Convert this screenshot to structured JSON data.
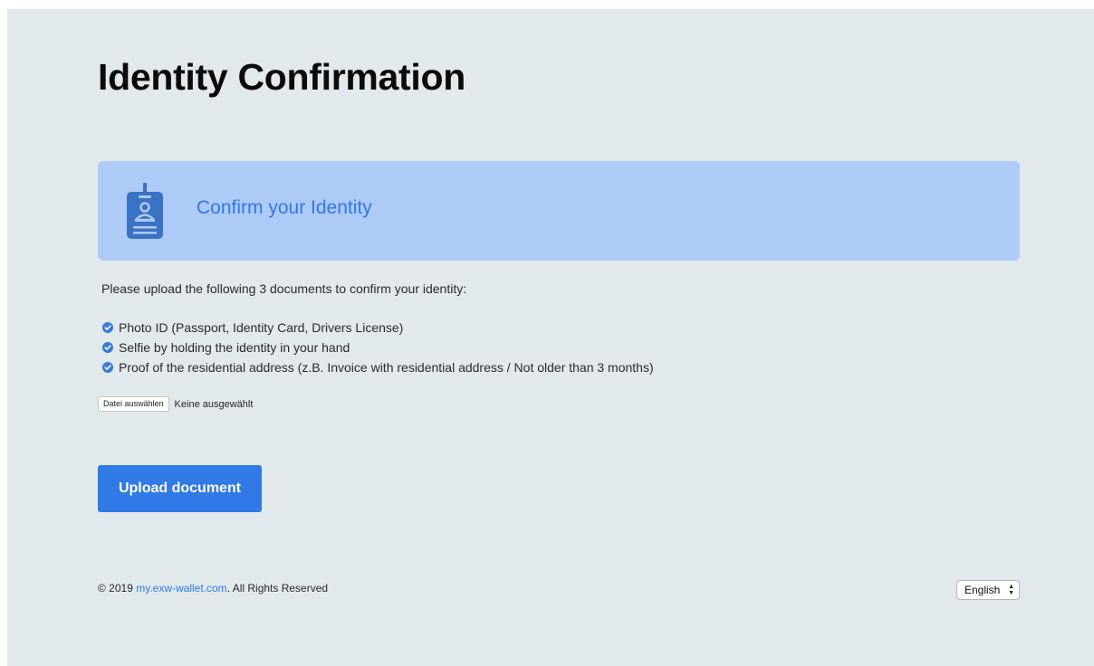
{
  "page": {
    "title": "Identity Confirmation"
  },
  "banner": {
    "title": "Confirm your Identity",
    "icon": "id-badge-icon"
  },
  "intro": "Please upload the following 3 documents to confirm your identity:",
  "documents": [
    "Photo ID (Passport, Identity Card, Drivers License)",
    "Selfie by holding the identity in your hand",
    "Proof of the residential address (z.B. Invoice with residential address / Not older than 3 months)"
  ],
  "file_input": {
    "button_label": "Datei auswählen",
    "status": "Keine ausgewählt"
  },
  "upload_button": "Upload document",
  "footer": {
    "prefix": "© 2019 ",
    "link": "my.exw-wallet.com",
    "suffix": ". All Rights Reserved",
    "language": "English"
  },
  "colors": {
    "accent": "#2f7ae5",
    "banner_bg": "#aecaf7",
    "page_bg": "#e2e9ed"
  }
}
